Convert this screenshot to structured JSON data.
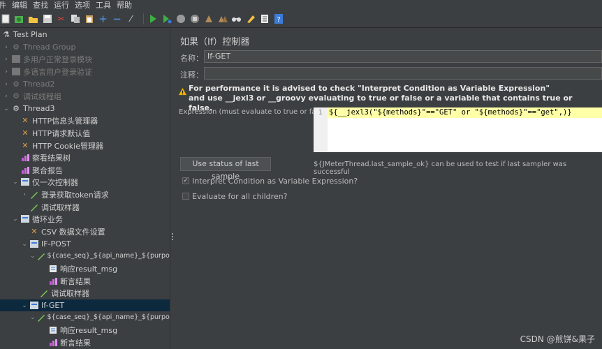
{
  "menu": [
    "件",
    "编辑",
    "查找",
    "运行",
    "选项",
    "工具",
    "帮助"
  ],
  "toolbar": {
    "icons": [
      "new-icon",
      "templates-icon",
      "open-icon",
      "save-icon",
      "cut-icon",
      "copy-icon",
      "paste-icon",
      "expand-icon",
      "collapse-icon",
      "toggle-icon",
      "start-icon",
      "start-no-pause-icon",
      "stop-icon",
      "shutdown-icon",
      "clear-icon",
      "clear-all-icon",
      "search-icon",
      "reset-search-icon",
      "function-helper-icon",
      "help-icon"
    ]
  },
  "tree": {
    "items": [
      {
        "label": "Test Plan",
        "dim": false
      },
      {
        "label": "Thread Group",
        "dim": true
      },
      {
        "label": "多用户正常登录模块",
        "dim": true
      },
      {
        "label": "多语言用户登录验证",
        "dim": true
      },
      {
        "label": "Thread2",
        "dim": true
      },
      {
        "label": "调试线程组",
        "dim": true
      },
      {
        "label": "Thread3",
        "dim": false
      },
      {
        "label": "HTTP信息头管理器",
        "dim": false
      },
      {
        "label": "HTTP请求默认值",
        "dim": false
      },
      {
        "label": "HTTP Cookie管理器",
        "dim": false
      },
      {
        "label": "察看结果树",
        "dim": false
      },
      {
        "label": "聚合报告",
        "dim": false
      },
      {
        "label": "仅一次控制器",
        "dim": false
      },
      {
        "label": "登录获取token请求",
        "dim": false
      },
      {
        "label": "调试取样器",
        "dim": false
      },
      {
        "label": "循环业务",
        "dim": false
      },
      {
        "label": "CSV 数据文件设置",
        "dim": false
      },
      {
        "label": "IF-POST",
        "dim": false
      },
      {
        "label": "${case_seq}_${api_name}_${purpose}",
        "dim": false
      },
      {
        "label": "响应result_msg",
        "dim": false
      },
      {
        "label": "断言结果",
        "dim": false
      },
      {
        "label": "调试取样器",
        "dim": false
      },
      {
        "label": "If-GET",
        "dim": false
      },
      {
        "label": "${case_seq}_${api_name}_${purpose}",
        "dim": false
      },
      {
        "label": "响应result_msg",
        "dim": false
      },
      {
        "label": "断言结果",
        "dim": false
      }
    ]
  },
  "panel": {
    "title": "如果（If）控制器",
    "name_label": "名称：",
    "name_value": "If-GET",
    "comment_label": "注释：",
    "comment_value": "",
    "warning_line1": "For performance it is advised to check \"Interpret Condition as Variable Expression\"",
    "warning_line2": "and use __jexl3 or __groovy evaluating to true or false or a variable that contains true or false.",
    "expression_label": "Expression (must evaluate to true or false)",
    "line_number": "1",
    "expression": "${__jexl3(\"${methods}\"==\"GET\" or \"${methods}\"==\"get\",)}",
    "use_status_button": "Use status of last sample",
    "hint": "${JMeterThread.last_sample_ok} can be used to test if last sampler was successful",
    "interpret_label": "Interpret Condition as Variable Expression?",
    "interpret_checked": true,
    "evaluate_all_label": "Evaluate for all children?",
    "evaluate_all_checked": false
  },
  "watermark": "CSDN @煎饼&果子",
  "colors": {
    "background": "#3c3f41",
    "selection": "#0d293e",
    "editor_highlight": "#ffffa8",
    "warning": "#f0b400"
  }
}
